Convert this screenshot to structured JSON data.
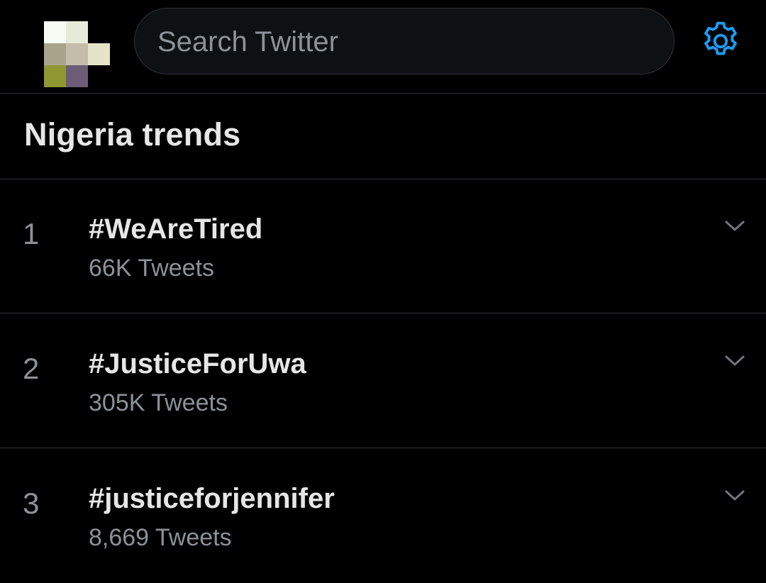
{
  "header": {
    "search": {
      "placeholder": "Search Twitter"
    },
    "settings_icon": "gear-icon",
    "avatar_colors": [
      [
        "#f6fbf3",
        "#e7ead8",
        null
      ],
      [
        "#a9a58d",
        "#c4bdac",
        "#e5e4c8"
      ],
      [
        "#8f9732",
        "#6d5c77",
        null
      ]
    ]
  },
  "section": {
    "title": "Nigeria trends"
  },
  "trends": [
    {
      "rank": "1",
      "name": "#WeAreTired",
      "count": "66K Tweets"
    },
    {
      "rank": "2",
      "name": "#JusticeForUwa",
      "count": "305K Tweets"
    },
    {
      "rank": "3",
      "name": "#justiceforjennifer",
      "count": "8,669 Tweets"
    }
  ],
  "colors": {
    "background": "#000000",
    "accent": "#1d9bf0",
    "text_primary": "#e6e6e6",
    "text_secondary": "#8b9298",
    "divider": "#2f3336"
  }
}
